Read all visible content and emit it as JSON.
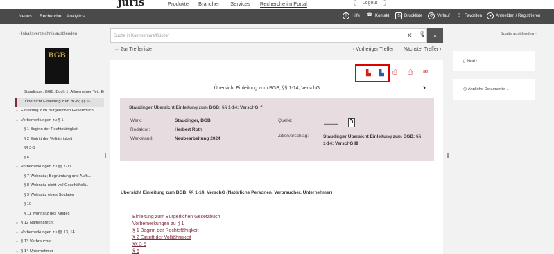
{
  "top": {
    "logo": "juris",
    "nav": [
      "Produkte",
      "Branchen",
      "Services",
      "Recherche im Portal"
    ],
    "logout": "Logout"
  },
  "bar": {
    "main": [
      "Neues",
      "Recherche",
      "Analytics"
    ],
    "right": [
      "Hilfe",
      "Kontakt",
      "Druckliste",
      "Verlauf",
      "Favoriten",
      "Anmelden / Registrieren"
    ]
  },
  "sidebar": {
    "hide_toc": "Inhaltsverzeichnis ausblenden",
    "book_label": "BGB",
    "toc": [
      {
        "label": "Staudinger, BGB, Buch 1, Allgemeiner Teil, Ei",
        "chev": "",
        "sel": false
      },
      {
        "label": "Übersicht Einleitung zum BGB; §§ 1-...",
        "chev": "",
        "sel": true
      },
      {
        "label": "Einleitung zum Bürgerlichen Gesetzbuch",
        "chev": "v",
        "sel": false
      },
      {
        "label": "Vorbemerkungen zu § 1",
        "chev": "v",
        "sel": false
      },
      {
        "label": "§ 1 Beginn der Rechtsfähigkeit",
        "chev": "",
        "sel": false
      },
      {
        "label": "§ 2 Eintritt der Volljährigkeit",
        "chev": "",
        "sel": false
      },
      {
        "label": "§§ 3-5",
        "chev": "",
        "sel": false
      },
      {
        "label": "§ 6",
        "chev": "",
        "sel": false
      },
      {
        "label": "Vorbemerkungen zu §§ 7-11",
        "chev": "v",
        "sel": false
      },
      {
        "label": "§ 7 Wohnsitz; Begründung und Aufh...",
        "chev": "",
        "sel": false
      },
      {
        "label": "§ 8 Wohnsitz nicht voll Geschäftsfä...",
        "chev": "",
        "sel": false
      },
      {
        "label": "§ 9 Wohnsitz eines Soldaten",
        "chev": "",
        "sel": false
      },
      {
        "label": "§ 10",
        "chev": "",
        "sel": false
      },
      {
        "label": "§ 11 Wohnsitz des Kindes",
        "chev": "",
        "sel": false
      },
      {
        "label": "§ 12 Namensrecht",
        "chev": "v",
        "sel": false
      },
      {
        "label": "Vorbemerkungen zu §§ 13, 14",
        "chev": "v",
        "sel": false
      },
      {
        "label": "§ 13 Verbraucher",
        "chev": "v",
        "sel": false
      },
      {
        "label": "§ 14 Unternehmer",
        "chev": "v",
        "sel": false
      }
    ]
  },
  "search": {
    "placeholder": "Suche in Kommentare/Bücher"
  },
  "nav": {
    "back": "Zur Trefferliste",
    "prev": "Vorheriger Treffer",
    "next": "Nächster Treffer"
  },
  "doc": {
    "head": "Übersicht Einleitung zum BGB; §§ 1-14; VerschG",
    "meta_title": "Staudinger Übersicht Einleitung zum BGB; §§ 1-14; VerschG",
    "werk_l": "Werk:",
    "werk_v": "Staudinger, BGB",
    "red_l": "Redaktor:",
    "red_v": "Herbert Roth",
    "stand_l": "Werkstand:",
    "stand_v": "Neubearbeitung 2024",
    "quelle_l": "Quelle:",
    "zitier_l": "Zitiervorschlag:",
    "zitier_v": "Staudinger Übersicht Einleitung zum BGB; §§ 1-14; VerschG",
    "title": "Übersicht Einleitung zum BGB; §§ 1-14; VerschG (Natürliche Personen, Verbraucher, Unternehmer)",
    "links": [
      "Einleitung zum Bürgerlichen Gesetzbuch",
      "Vorbemerkungen zu § 1",
      "§ 1 Beginn der Rechtsfähigkeit",
      "§ 2 Eintritt der Volljährigkeit",
      "§§ 3-5",
      "§ 6"
    ]
  },
  "right": {
    "notiz": "Notiz",
    "spalte": "Spalte ausblenden",
    "aehnlich": "Ähnliche Dokumente"
  },
  "colors": {
    "accent": "#7b2d3b",
    "bar": "#4a4a4a",
    "meta_bg": "#e7dde1",
    "highlight": "#e00000"
  }
}
